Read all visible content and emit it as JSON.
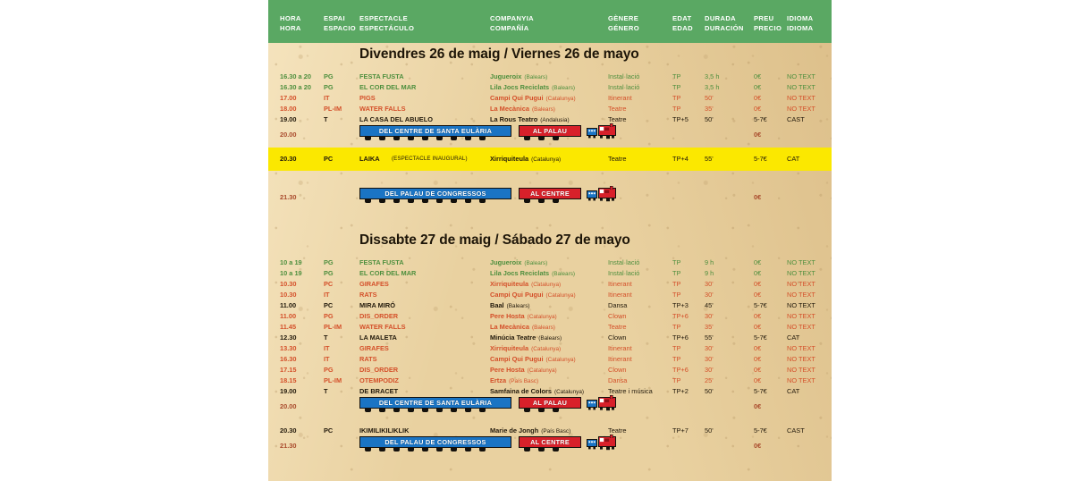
{
  "meta": {
    "paper_color": "#e9d1a0",
    "header_green": "#5aa863",
    "highlight_yellow": "#fbe800",
    "green_text": "#4e8f3e",
    "red_text": "#d4502a",
    "dark_text": "#22190b",
    "banner_blue": "#1a74c4",
    "banner_red": "#d8202a"
  },
  "header": {
    "columns": [
      {
        "ca": "HORA",
        "es": "HORA"
      },
      {
        "ca": "ESPAI",
        "es": "ESPACIO"
      },
      {
        "ca": "ESPECTACLE",
        "es": "ESPECTÁCULO"
      },
      {
        "ca": "COMPANYIA",
        "es": "COMPAÑÍA"
      },
      {
        "ca": "GÈNERE",
        "es": "GÉNERO"
      },
      {
        "ca": "EDAT",
        "es": "EDAD"
      },
      {
        "ca": "DURADA",
        "es": "DURACIÓN"
      },
      {
        "ca": "PREU",
        "es": "PRECIO"
      },
      {
        "ca": "IDIOMA",
        "es": "IDIOMA"
      }
    ]
  },
  "days": [
    {
      "title": "Divendres 26 de maig / Viernes 26 de mayo",
      "rows": [
        {
          "kind": "show",
          "color": "green",
          "time": "16.30 a 20",
          "space": "PG",
          "show": "FESTA FUSTA",
          "sub": "",
          "company": "Jugueroix",
          "origin": "(Balears)",
          "genre": "Instal·lació",
          "age": "TP",
          "dur": "3,5 h",
          "price": "0€",
          "lang": "NO TEXT"
        },
        {
          "kind": "show",
          "color": "green",
          "time": "16.30 a 20",
          "space": "PG",
          "show": "EL COR DEL MAR",
          "sub": "",
          "company": "Lila Jocs Reciclats",
          "origin": "(Balears)",
          "genre": "Instal·lació",
          "age": "TP",
          "dur": "3,5 h",
          "price": "0€",
          "lang": "NO TEXT"
        },
        {
          "kind": "show",
          "color": "red",
          "time": "17.00",
          "space": "IT",
          "show": "PIGS",
          "sub": "",
          "company": "Campi Qui Pugui",
          "origin": "(Catalunya)",
          "genre": "Itinerant",
          "age": "TP",
          "dur": "50'",
          "price": "0€",
          "lang": "NO TEXT"
        },
        {
          "kind": "show",
          "color": "red",
          "time": "18.00",
          "space": "PL-IM",
          "show": "WATER FALLS",
          "sub": "",
          "company": "La Mecànica",
          "origin": "(Balears)",
          "genre": "Teatre",
          "age": "TP",
          "dur": "35'",
          "price": "0€",
          "lang": "NO TEXT"
        },
        {
          "kind": "show",
          "color": "dark",
          "time": "19.00",
          "space": "T",
          "show": "LA CASA DEL ABUELO",
          "sub": "",
          "company": "La Rous Teatro",
          "origin": "(Andalusia)",
          "genre": "Teatre",
          "age": "TP+5",
          "dur": "50'",
          "price": "5-7€",
          "lang": "CAST"
        },
        {
          "kind": "train",
          "time": "20.00",
          "blue": "DEL CENTRE DE SANTA EULÀRIA",
          "red": "AL PALAU",
          "price": "0€"
        },
        {
          "kind": "highlight",
          "time": "20.30",
          "space": "PC",
          "show": "LAIKA",
          "sub": "(ESPECTACLE INAUGURAL)",
          "company": "Xirriquiteula",
          "origin": "(Catalunya)",
          "genre": "Teatre",
          "age": "TP+4",
          "dur": "55'",
          "price": "5-7€",
          "lang": "CAT"
        },
        {
          "kind": "train",
          "time": "21.30",
          "blue": "DEL PALAU DE CONGRESSOS",
          "red": "AL CENTRE",
          "price": "0€"
        }
      ]
    },
    {
      "title": "Dissabte 27 de maig / Sábado 27 de mayo",
      "rows": [
        {
          "kind": "show",
          "color": "green",
          "time": "10 a 19",
          "space": "PG",
          "show": "FESTA FUSTA",
          "sub": "",
          "company": "Jugueroix",
          "origin": "(Balears)",
          "genre": "Instal·lació",
          "age": "TP",
          "dur": "9 h",
          "price": "0€",
          "lang": "NO TEXT"
        },
        {
          "kind": "show",
          "color": "green",
          "time": "10 a 19",
          "space": "PG",
          "show": "EL COR DEL MAR",
          "sub": "",
          "company": "Lila Jocs Reciclats",
          "origin": "(Balears)",
          "genre": "Instal·lació",
          "age": "TP",
          "dur": "9 h",
          "price": "0€",
          "lang": "NO TEXT"
        },
        {
          "kind": "show",
          "color": "red",
          "time": "10.30",
          "space": "PC",
          "show": "GIRAFES",
          "sub": "",
          "company": "Xirriquiteula",
          "origin": "(Catalunya)",
          "genre": "Itinerant",
          "age": "TP",
          "dur": "30'",
          "price": "0€",
          "lang": "NO TEXT"
        },
        {
          "kind": "show",
          "color": "red",
          "time": "10.30",
          "space": "IT",
          "show": "RATS",
          "sub": "",
          "company": "Campi Qui Pugui",
          "origin": "(Catalunya)",
          "genre": "Itinerant",
          "age": "TP",
          "dur": "30'",
          "price": "0€",
          "lang": "NO TEXT"
        },
        {
          "kind": "show",
          "color": "dark",
          "time": "11.00",
          "space": "PC",
          "show": "MIRA MIRÓ",
          "sub": "",
          "company": "Baal",
          "origin": "(Balears)",
          "genre": "Dansa",
          "age": "TP+3",
          "dur": "45'",
          "price": "5-7€",
          "lang": "NO TEXT"
        },
        {
          "kind": "show",
          "color": "red",
          "time": "11.00",
          "space": "PG",
          "show": "DIS_ORDER",
          "sub": "",
          "company": "Pere Hosta",
          "origin": "(Catalunya)",
          "genre": "Clown",
          "age": "TP+6",
          "dur": "30'",
          "price": "0€",
          "lang": "NO TEXT"
        },
        {
          "kind": "show",
          "color": "red",
          "time": "11.45",
          "space": "PL-IM",
          "show": "WATER FALLS",
          "sub": "",
          "company": "La Mecànica",
          "origin": "(Balears)",
          "genre": "Teatre",
          "age": "TP",
          "dur": "35'",
          "price": "0€",
          "lang": "NO TEXT"
        },
        {
          "kind": "show",
          "color": "dark",
          "time": "12.30",
          "space": "T",
          "show": "LA MALETA",
          "sub": "",
          "company": "Minúcia Teatre",
          "origin": "(Balears)",
          "genre": "Clown",
          "age": "TP+6",
          "dur": "55'",
          "price": "5-7€",
          "lang": "CAT"
        },
        {
          "kind": "show",
          "color": "red",
          "time": "13.30",
          "space": "IT",
          "show": "GIRAFES",
          "sub": "",
          "company": "Xirriquiteula",
          "origin": "(Catalunya)",
          "genre": "Itinerant",
          "age": "TP",
          "dur": "30'",
          "price": "0€",
          "lang": "NO TEXT"
        },
        {
          "kind": "show",
          "color": "red",
          "time": "16.30",
          "space": "IT",
          "show": "RATS",
          "sub": "",
          "company": "Campi Qui Pugui",
          "origin": "(Catalunya)",
          "genre": "Itinerant",
          "age": "TP",
          "dur": "30'",
          "price": "0€",
          "lang": "NO TEXT"
        },
        {
          "kind": "show",
          "color": "red",
          "time": "17.15",
          "space": "PG",
          "show": "DIS_ORDER",
          "sub": "",
          "company": "Pere Hosta",
          "origin": "(Catalunya)",
          "genre": "Clown",
          "age": "TP+6",
          "dur": "30'",
          "price": "0€",
          "lang": "NO TEXT"
        },
        {
          "kind": "show",
          "color": "red",
          "time": "18.15",
          "space": "PL-IM",
          "show": "OTEMPODIZ",
          "sub": "",
          "company": "Ertza",
          "origin": "(País Basc)",
          "genre": "Dansa",
          "age": "TP",
          "dur": "25'",
          "price": "0€",
          "lang": "NO TEXT"
        },
        {
          "kind": "show",
          "color": "dark",
          "time": "19.00",
          "space": "T",
          "show": "DE BRACET",
          "sub": "",
          "company": "Samfaina de Colors",
          "origin": "(Catalunya)",
          "genre": "Teatre i música",
          "age": "TP+2",
          "dur": "50'",
          "price": "5-7€",
          "lang": "CAT"
        },
        {
          "kind": "train",
          "time": "20.00",
          "blue": "DEL CENTRE DE SANTA EULÀRIA",
          "red": "AL PALAU",
          "price": "0€"
        },
        {
          "kind": "show",
          "color": "dark",
          "time": "20.30",
          "space": "PC",
          "show": "IKIMILIKILIKLIK",
          "sub": "",
          "company": "Marie de Jongh",
          "origin": "(País Basc)",
          "genre": "Teatre",
          "age": "TP+7",
          "dur": "50'",
          "price": "5-7€",
          "lang": "CAST"
        },
        {
          "kind": "train",
          "time": "21.30",
          "blue": "DEL PALAU DE CONGRESSOS",
          "red": "AL CENTRE",
          "price": "0€"
        }
      ]
    }
  ]
}
